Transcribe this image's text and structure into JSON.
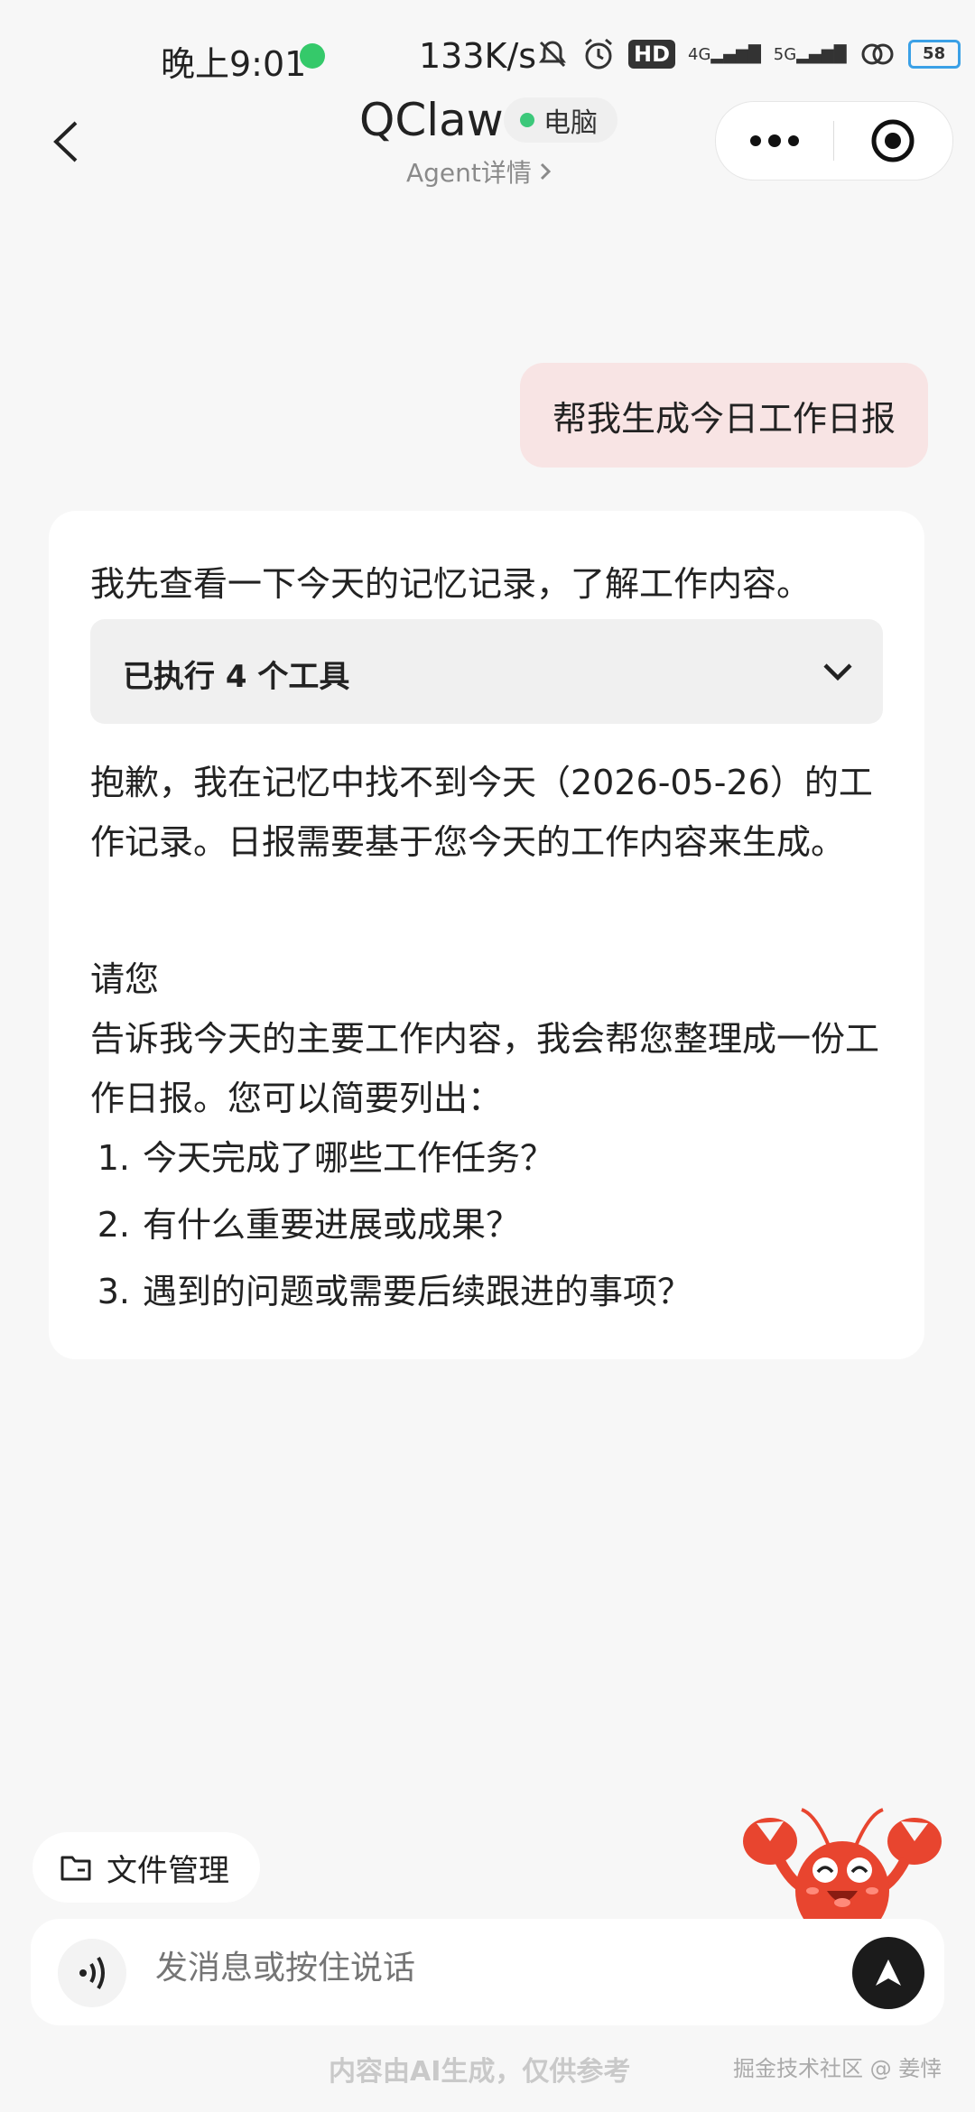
{
  "status_bar": {
    "time": "晚上9:01",
    "network_speed": "133K/s",
    "hd_label": "HD",
    "signal_1_label": "4G",
    "signal_2_label": "5G",
    "battery_level": "58"
  },
  "header": {
    "title": "QClaw",
    "device_label": "电脑",
    "agent_link_label": "Agent详情"
  },
  "messages": {
    "user_message": "帮我生成今日工作日报",
    "assistant": {
      "intro": "我先查看一下今天的记忆记录，了解工作内容。",
      "tools_label": "已执行 4 个工具",
      "paragraph_1": "抱歉，我在记忆中找不到今天（2026-05-26）的工作记录。日报需要基于您今天的工作内容来生成。",
      "paragraph_2": "请您\n告诉我今天的主要工作内容，我会帮您整理成一份工作日报。您可以简要列出：",
      "list": [
        {
          "num": "1.",
          "text": "今天完成了哪些工作任务？"
        },
        {
          "num": "2.",
          "text": "有什么重要进展或成果？"
        },
        {
          "num": "3.",
          "text": "遇到的问题或需要后续跟进的事项？"
        }
      ]
    }
  },
  "bottom": {
    "file_manager_label": "文件管理",
    "input_placeholder": "发消息或按住说话",
    "footer_note": "内容由AI生成，仅供参考",
    "watermark": "掘金技术社区 @ 姜悻"
  },
  "colors": {
    "user_bubble": "#f8e4e4",
    "device_dot": "#3cc87a",
    "send_button": "#1b1b1b"
  }
}
